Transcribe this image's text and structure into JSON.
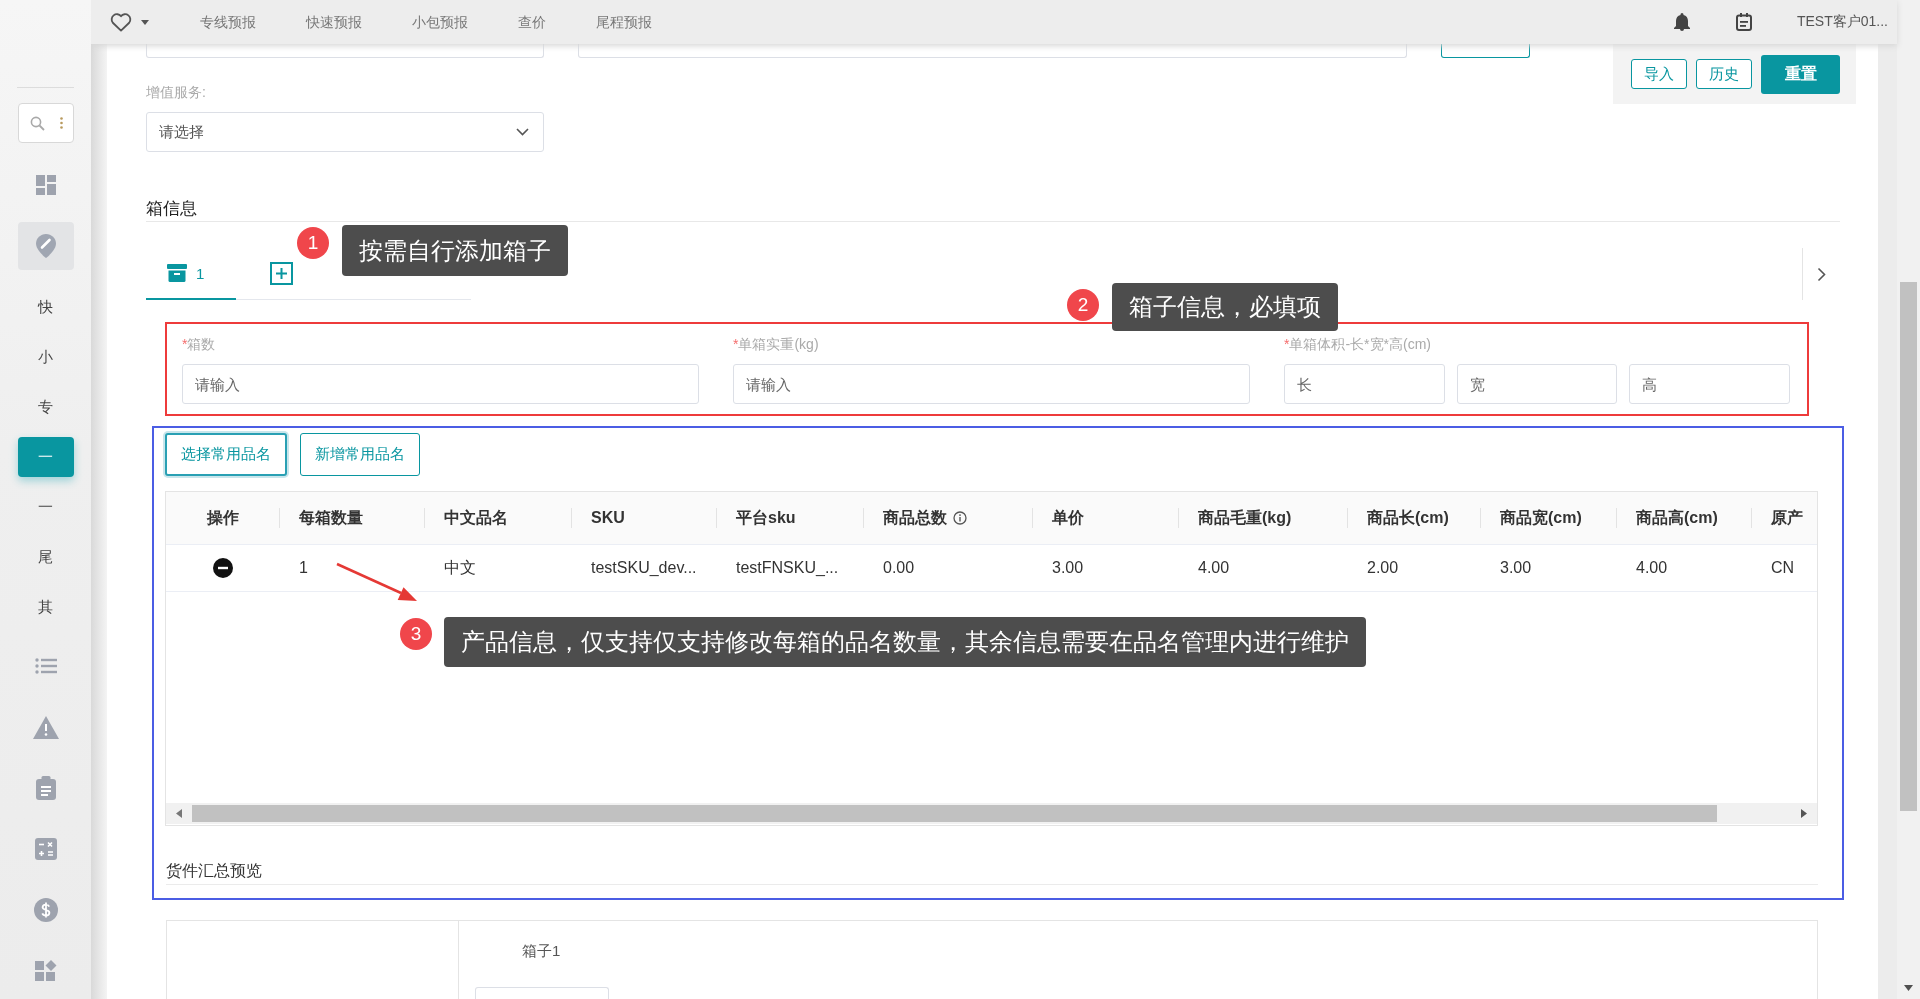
{
  "top_bar": {
    "nav": [
      {
        "label": "专线预报",
        "selected": false
      },
      {
        "label": "快速预报",
        "selected": false
      },
      {
        "label": "小包预报",
        "selected": false
      },
      {
        "label": "查价",
        "selected": false
      },
      {
        "label": "尾程预报",
        "selected": false
      }
    ],
    "user": "TEST客户01..."
  },
  "sidebar": {
    "group": {
      "expanded": true,
      "items": [
        {
          "label": "快",
          "selected": false
        },
        {
          "label": "小",
          "selected": false
        },
        {
          "label": "专",
          "selected": false
        },
        {
          "label": "一",
          "selected": true
        },
        {
          "label": "一",
          "selected": false
        },
        {
          "label": "尾",
          "selected": false
        },
        {
          "label": "其",
          "selected": false
        }
      ]
    }
  },
  "actions": [
    {
      "label": "导入",
      "kind": "outline"
    },
    {
      "label": "历史",
      "kind": "outline"
    },
    {
      "label": "重置",
      "kind": "primary"
    }
  ],
  "value_added_service": {
    "label": "增值服务:",
    "placeholder": "请选择"
  },
  "box_info": {
    "title": "箱信息",
    "tabs": [
      {
        "label": "1",
        "selected": true
      }
    ],
    "fields": [
      {
        "kind": "single",
        "required_mark": "*",
        "label": "箱数",
        "placeholder": "请输入"
      },
      {
        "kind": "single",
        "required_mark": "*",
        "label": "单箱实重(kg)",
        "placeholder": "请输入"
      },
      {
        "kind": "triple",
        "required_mark": "*",
        "label": "单箱体积-长*宽*高(cm)",
        "parts": [
          {
            "placeholder": "长"
          },
          {
            "placeholder": "宽"
          },
          {
            "placeholder": "高"
          }
        ]
      }
    ]
  },
  "products": {
    "buttons": [
      {
        "label": "选择常用品名",
        "focused": true
      },
      {
        "label": "新增常用品名",
        "focused": false
      }
    ],
    "table": {
      "action_column": {
        "label": "操作"
      },
      "columns": [
        {
          "label": "每箱数量",
          "info_icon": false
        },
        {
          "label": "中文品名",
          "info_icon": false
        },
        {
          "label": "SKU",
          "info_icon": false
        },
        {
          "label": "平台sku",
          "info_icon": false
        },
        {
          "label": "商品总数",
          "info_icon": true
        },
        {
          "label": "单价",
          "info_icon": false
        },
        {
          "label": "商品毛重(kg)",
          "info_icon": false
        },
        {
          "label": "商品长(cm)",
          "info_icon": false
        },
        {
          "label": "商品宽(cm)",
          "info_icon": false
        },
        {
          "label": "商品高(cm)",
          "info_icon": false
        },
        {
          "label": "原产",
          "info_icon": false
        }
      ],
      "rows": [
        {
          "removable": true,
          "cells": [
            "1",
            "中文",
            "testSKU_dev...",
            "testFNSKU_...",
            "0.00",
            "3.00",
            "4.00",
            "2.00",
            "3.00",
            "4.00",
            "CN"
          ]
        }
      ]
    },
    "summary_title": "货件汇总预览"
  },
  "summary": {
    "box_label": "箱子1"
  },
  "annotations": [
    {
      "number": "1",
      "text": "按需自行添加箱子"
    },
    {
      "number": "2",
      "text": "箱子信息，必填项"
    },
    {
      "number": "3",
      "text": "产品信息，仅支持仅支持修改每箱的品名数量，其余信息需要在品名管理内进行维护"
    }
  ],
  "highlight_frames": [
    {
      "color": "#ee3b3b"
    },
    {
      "color": "#4b5de4"
    }
  ]
}
